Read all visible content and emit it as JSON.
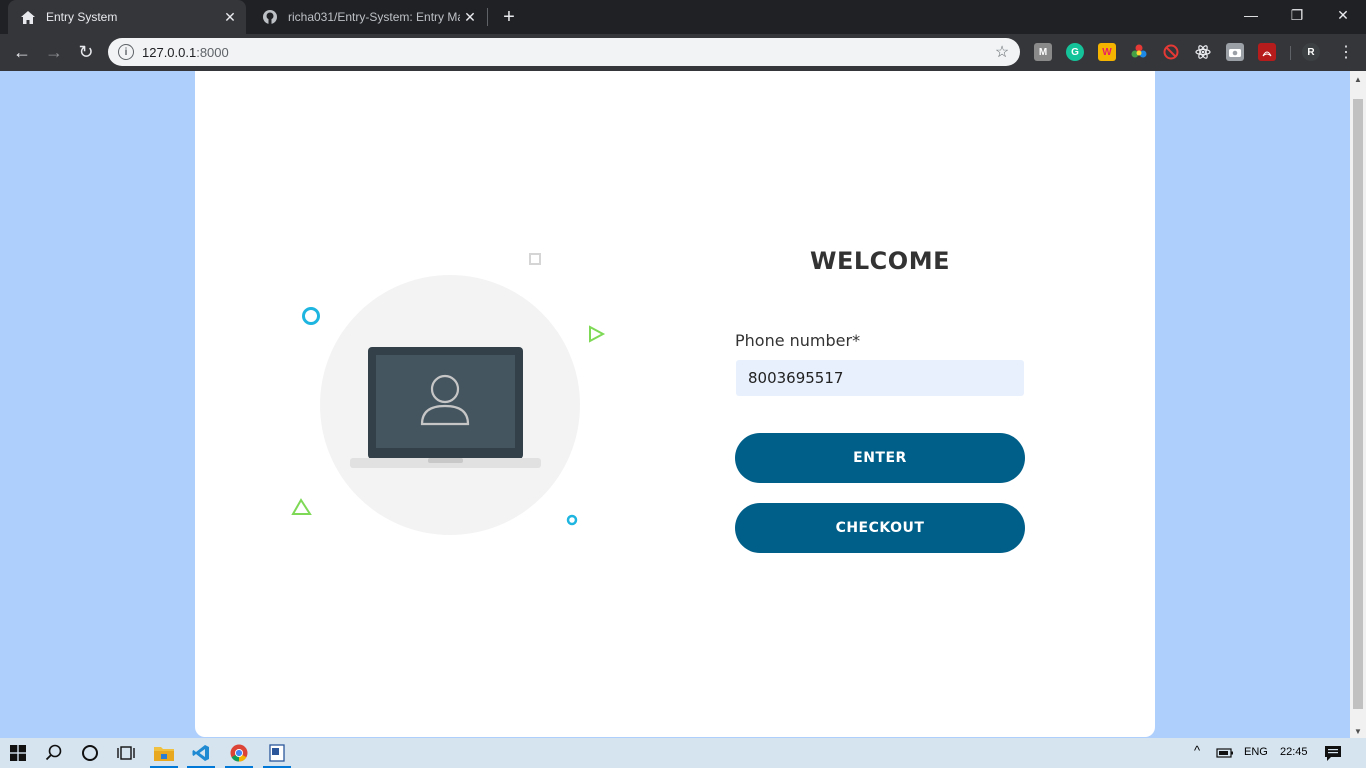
{
  "browser": {
    "tabs": [
      {
        "title": "Entry System",
        "icon": "home-icon",
        "active": true
      },
      {
        "title": "richa031/Entry-System: Entry Ma",
        "icon": "github-icon",
        "active": false
      }
    ],
    "url_host": "127.0.0.1",
    "url_port": ":8000",
    "extensions": [
      "M",
      "G",
      "W",
      "R"
    ]
  },
  "page": {
    "welcome": "WELCOME",
    "phone_label": "Phone number*",
    "phone_value": "8003695517",
    "enter_label": "ENTER",
    "checkout_label": "CHECKOUT",
    "colors": {
      "accent": "#005f89",
      "background": "#aecffb",
      "input_bg": "#e8f0fe"
    }
  },
  "taskbar": {
    "language": "ENG",
    "time": "22:45"
  }
}
